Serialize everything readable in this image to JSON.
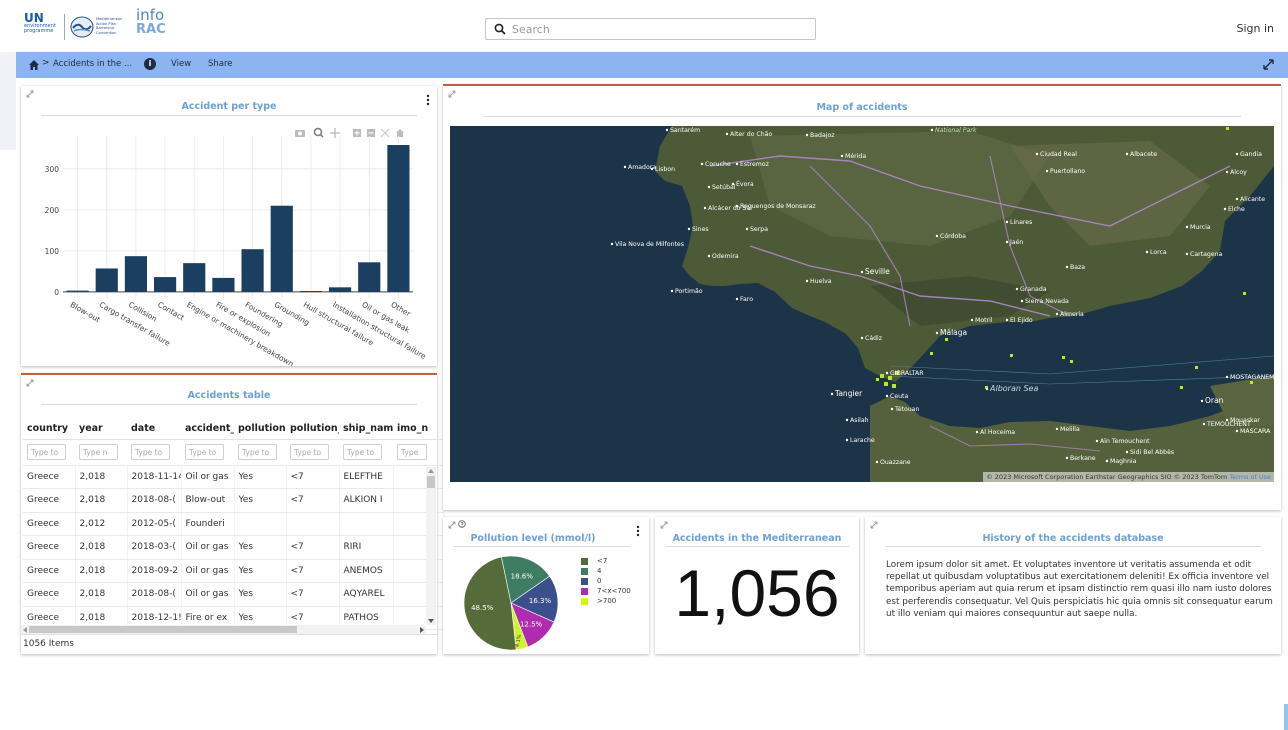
{
  "header": {
    "logo_un_title": "UN",
    "logo_un_sub": "environment programme",
    "logo_map_text": "Mediterranean Action Plan Barcelona Convention",
    "logo_info_top": "info",
    "logo_info_bottom": "RAC",
    "search_placeholder": "Search",
    "signin_label": "Sign in"
  },
  "nav": {
    "breadcrumb_chevron": ">",
    "breadcrumb": "Accidents in the ...",
    "info": "i",
    "view_label": "View",
    "share_label": "Share"
  },
  "bar_card": {
    "title": "Accident per type",
    "chart_data": {
      "type": "bar",
      "title": "Accident per type",
      "categories": [
        "Blow-out",
        "Cargo transfer failure",
        "Collision",
        "Contact",
        "Engine or machinery breakdown",
        "Fire or explosion",
        "Foundering",
        "Grounding",
        "Hull structural failure",
        "Installation structural failure",
        "Oil or gas leak",
        "Other"
      ],
      "values": [
        3,
        57,
        87,
        36,
        70,
        34,
        104,
        210,
        2,
        11,
        72,
        358
      ],
      "yticks": [
        0,
        100,
        200,
        300
      ],
      "ylim": [
        -15,
        380
      ],
      "color": "#1b3f61",
      "grid": true
    }
  },
  "table_card": {
    "title": "Accidents table",
    "columns": [
      "country",
      "year",
      "date",
      "accident_",
      "pollution",
      "pollution_",
      "ship_nam",
      "imo_n"
    ],
    "filter_placeholders": [
      "Type to",
      "Type n",
      "Type to",
      "Type to",
      "Type to",
      "Type to",
      "Type to",
      "Type"
    ],
    "rows": [
      [
        "Greece",
        "2,018",
        "2018-11-14",
        "Oil or gas",
        "Yes",
        "<7",
        "ELEFTHE",
        ""
      ],
      [
        "Greece",
        "2,018",
        "2018-08-(",
        "Blow-out",
        "Yes",
        "<7",
        "ALKION I",
        ""
      ],
      [
        "Greece",
        "2,012",
        "2012-05-(",
        "Founderi",
        "",
        "",
        "",
        ""
      ],
      [
        "Greece",
        "2,018",
        "2018-03-(",
        "Oil or gas",
        "Yes",
        "<7",
        "RIRI",
        ""
      ],
      [
        "Greece",
        "2,018",
        "2018-09-2",
        "Oil or gas",
        "Yes",
        "<7",
        "ANEMOS",
        ""
      ],
      [
        "Greece",
        "2,018",
        "2018-08-(",
        "Oil or gas",
        "Yes",
        "<7",
        "AQYAREL",
        ""
      ],
      [
        "Greece",
        "2,018",
        "2018-12-1!",
        "Fire or ex",
        "Yes",
        "<7",
        "PATHOS",
        ""
      ]
    ],
    "footer": "1056 Items"
  },
  "map_card": {
    "title": "Map of accidents",
    "labels": [
      "Santarém",
      "Alter do Chão",
      "Badajoz",
      "Mérida",
      "Ciudad Real",
      "Albacete",
      "Gandia",
      "Amadora",
      "Lisbon",
      "Coruche",
      "Estremoz",
      "Puertollano",
      "Alcoy",
      "Setúbal",
      "Évora",
      "Elche",
      "Alicante",
      "Alcácer do Sal",
      "Reguengos de Monsaraz",
      "Linares",
      "Murcia",
      "Sines",
      "Serpa",
      "Córdoba",
      "Jaén",
      "Vila Nova de Milfontes",
      "Odemira",
      "Lorca",
      "Cartagena",
      "Seville",
      "Baza",
      "Portimão",
      "Faro",
      "Huelva",
      "Granada",
      "Sierra Nevada",
      "Málaga",
      "Motril",
      "El Ejido",
      "Almería",
      "Cádiz",
      "GIBRALTAR",
      "Tangier",
      "Ceuta",
      "Tétouan",
      "Alboran Sea",
      "Oran",
      "Al Hoceima",
      "Melilla",
      "Aïn Temouchent",
      "Sidi Bel Abbès",
      "Berkane",
      "Maghnia",
      "Larache",
      "Ouazzane",
      "Asilah",
      "MOSTAGANEM",
      "MASCARA",
      "TEMOUCHENT",
      "Mouaskar",
      "National Park"
    ],
    "attribution": "© 2023 Microsoft Corporation Earthstar Geographics SIO © 2023 TomTom",
    "terms": "Terms of Use"
  },
  "pie_card": {
    "title": "Pollution level (mmol/l)",
    "chart_data": {
      "type": "pie",
      "title": "Pollution level (mmol/l)",
      "slices": [
        {
          "label": ">700",
          "value": 4.1,
          "color": "#d2f22b",
          "text": "4.1%"
        },
        {
          "label": "<7",
          "value": 48.5,
          "color": "#556b3a",
          "text": "48.5%"
        },
        {
          "label": "4",
          "value": 18.6,
          "color": "#3f7d62",
          "text": "18.6%"
        },
        {
          "label": "0",
          "value": 16.3,
          "color": "#3a4f8c",
          "text": "16.3%"
        },
        {
          "label": "7<x<700",
          "value": 12.5,
          "color": "#b02cae",
          "text": "12.5%"
        }
      ],
      "legend": [
        {
          "label": "<7",
          "color": "#556b3a"
        },
        {
          "label": "4",
          "color": "#3f7d62"
        },
        {
          "label": "0",
          "color": "#3a4f8c"
        },
        {
          "label": "7<x<700",
          "color": "#b02cae"
        },
        {
          "label": ">700",
          "color": "#d2f22b"
        }
      ],
      "legend_position": "right"
    }
  },
  "count_card": {
    "title": "Accidents in the Mediterranean",
    "value": "1,056"
  },
  "history_card": {
    "title": "History of the accidents database",
    "text": "Lorem ipsum dolor sit amet. Et voluptates inventore ut veritatis assumenda et odit repellat ut quibusdam voluptatibus aut exercitationem deleniti! Ex officia inventore vel temporibus aperiam aut quia rerum et ipsam distinctio rem quasi illo nam iusto dolores est perferendis consequatur. Vel Quis perspiciatis hic quia omnis sit consequatur earum ut illo veniam qui maiores consequuntur aut saepe nulla."
  }
}
